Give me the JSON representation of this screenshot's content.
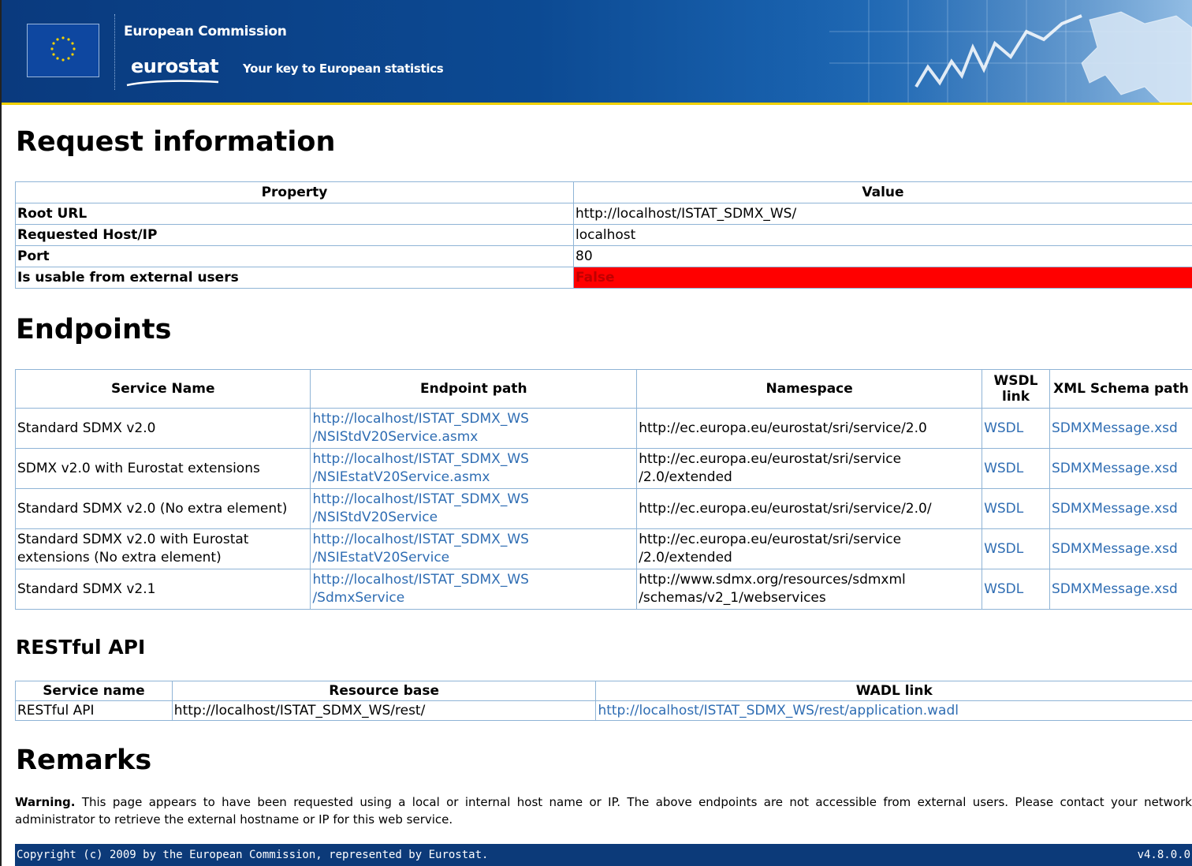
{
  "banner": {
    "org": "European Commission",
    "brand": "eurostat",
    "tagline": "Your key to European statistics"
  },
  "request_info": {
    "heading": "Request information",
    "headers": [
      "Property",
      "Value"
    ],
    "rows": [
      {
        "property": "Root URL",
        "value": "http://localhost/ISTAT_SDMX_WS/"
      },
      {
        "property": "Requested Host/IP",
        "value": "localhost"
      },
      {
        "property": "Port",
        "value": "80"
      },
      {
        "property": "Is usable from external users",
        "value": "False"
      }
    ]
  },
  "endpoints": {
    "heading": "Endpoints",
    "headers": [
      "Service Name",
      "Endpoint path",
      "Namespace",
      "WSDL link",
      "XML Schema path"
    ],
    "rows": [
      {
        "name": "Standard SDMX v2.0",
        "path": "http://localhost/ISTAT_SDMX_WS/NSIStdV20Service.asmx",
        "path_l1": "http://localhost/ISTAT_SDMX_WS",
        "path_l2": "/NSIStdV20Service.asmx",
        "ns_l1": "http://ec.europa.eu/eurostat/sri/service/2.0",
        "ns_l2": "",
        "wsdl": "WSDL",
        "xsd": "SDMXMessage.xsd"
      },
      {
        "name": "SDMX v2.0 with Eurostat extensions",
        "path_l1": "http://localhost/ISTAT_SDMX_WS",
        "path_l2": "/NSIEstatV20Service.asmx",
        "ns_l1": "http://ec.europa.eu/eurostat/sri/service",
        "ns_l2": "/2.0/extended",
        "wsdl": "WSDL",
        "xsd": "SDMXMessage.xsd"
      },
      {
        "name": "Standard SDMX v2.0 (No extra element)",
        "path_l1": "http://localhost/ISTAT_SDMX_WS",
        "path_l2": "/NSIStdV20Service",
        "ns_l1": "http://ec.europa.eu/eurostat/sri/service/2.0/",
        "ns_l2": "",
        "wsdl": "WSDL",
        "xsd": "SDMXMessage.xsd"
      },
      {
        "name": "Standard SDMX v2.0 with Eurostat extensions (No extra element)",
        "path_l1": "http://localhost/ISTAT_SDMX_WS",
        "path_l2": "/NSIEstatV20Service",
        "ns_l1": "http://ec.europa.eu/eurostat/sri/service",
        "ns_l2": "/2.0/extended",
        "wsdl": "WSDL",
        "xsd": "SDMXMessage.xsd"
      },
      {
        "name": "Standard SDMX v2.1",
        "path_l1": "http://localhost/ISTAT_SDMX_WS",
        "path_l2": "/SdmxService",
        "ns_l1": "http://www.sdmx.org/resources/sdmxml",
        "ns_l2": "/schemas/v2_1/webservices",
        "wsdl": "WSDL",
        "xsd": "SDMXMessage.xsd"
      }
    ]
  },
  "restful": {
    "heading": "RESTful API",
    "headers": [
      "Service name",
      "Resource base",
      "WADL link"
    ],
    "rows": [
      {
        "name": "RESTful API",
        "base": "http://localhost/ISTAT_SDMX_WS/rest/",
        "wadl": "http://localhost/ISTAT_SDMX_WS/rest/application.wadl"
      }
    ]
  },
  "remarks": {
    "heading": "Remarks",
    "warning_label": "Warning.",
    "text": "This page appears to have been requested using a local or internal host name or IP. The above endpoints are not accessible from external users. Please contact your network administrator to retrieve the external hostname or IP for this web service."
  },
  "footer": {
    "copyright": "Copyright (c) 2009 by the European Commission, represented by Eurostat.",
    "version": "v4.8.0.0"
  },
  "colors": {
    "banner_blue": "#0c4a93",
    "footer_blue": "#0c3a79",
    "link": "#2f6db3",
    "false_bg": "#ff0000",
    "table_border": "#8fb4d6"
  }
}
